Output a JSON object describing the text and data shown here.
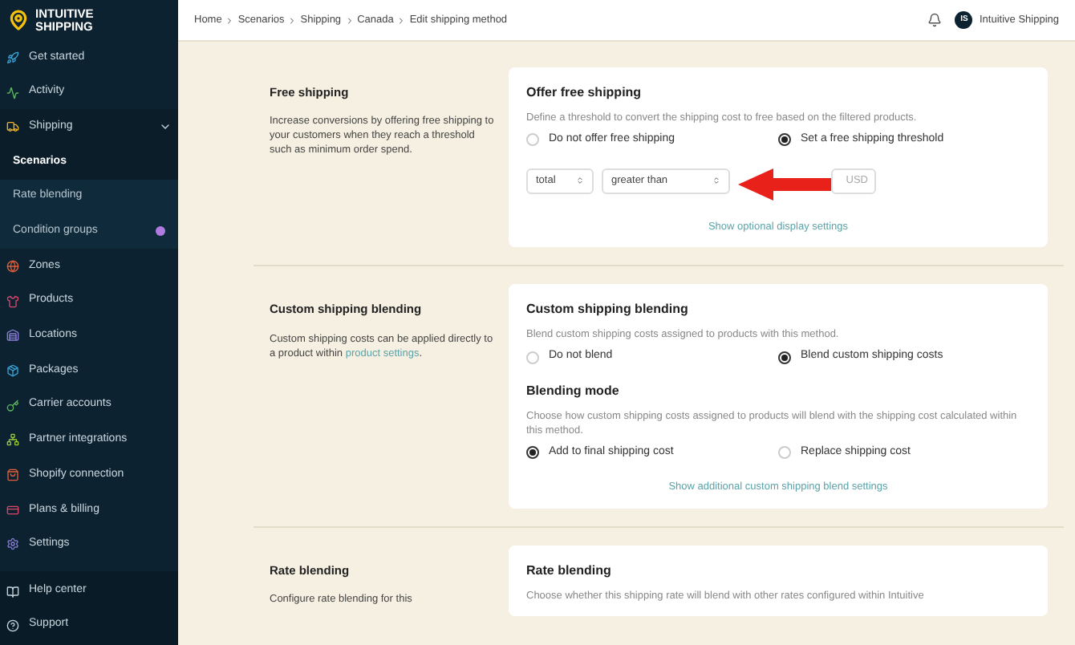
{
  "brand": {
    "line1": "INTUITIVE",
    "line2": "SHIPPING"
  },
  "sidebar": {
    "items": [
      {
        "label": "Get started",
        "selected": false
      },
      {
        "label": "Activity",
        "selected": false
      },
      {
        "label": "Shipping",
        "selected": false,
        "expanded": true,
        "children": [
          {
            "label": "Scenarios",
            "selected": true
          },
          {
            "label": "Rate blending",
            "selected": false
          },
          {
            "label": "Condition groups",
            "selected": false,
            "color": "#b07be0"
          }
        ]
      },
      {
        "label": "Zones",
        "selected": false
      },
      {
        "label": "Products",
        "selected": false
      },
      {
        "label": "Locations",
        "selected": false
      },
      {
        "label": "Packages",
        "selected": false
      },
      {
        "label": "Carrier accounts",
        "selected": false
      },
      {
        "label": "Partner integrations",
        "selected": false
      },
      {
        "label": "Shopify connection",
        "selected": false
      },
      {
        "label": "Plans & billing",
        "selected": false
      },
      {
        "label": "Settings",
        "selected": false
      }
    ],
    "footer": [
      {
        "label": "Help center"
      },
      {
        "label": "Support"
      }
    ]
  },
  "topbar": {
    "breadcrumbs": [
      "Home",
      "Scenarios",
      "Shipping",
      "Canada",
      "Edit shipping method"
    ],
    "avatar": "IS",
    "account": "Intuitive Shipping"
  },
  "sections": [
    {
      "title": "Free shipping",
      "description": "Increase conversions by offering free shipping to your customers when they reach a threshold such as minimum order spend.",
      "card": {
        "blocks": [
          {
            "title": "Offer free shipping",
            "text": "Define a threshold to convert the shipping cost to free based on the filtered products.",
            "options": [
              {
                "label": "Do not offer free shipping",
                "selected": false
              },
              {
                "label": "Set a free shipping threshold",
                "selected": true
              }
            ]
          }
        ],
        "selects": [
          "total",
          "greater than"
        ],
        "suffix": "USD",
        "link": "Show optional display settings"
      }
    },
    {
      "title": "Custom shipping blending",
      "description": "Custom shipping costs can be applied directly to a product within",
      "link": "product settings",
      "description_end": ".",
      "card": {
        "blocks": [
          {
            "title": "Custom shipping blending",
            "text": "Blend custom shipping costs assigned to products with this method.",
            "options": [
              {
                "label": "Do not blend",
                "selected": false
              },
              {
                "label": "Blend custom shipping costs",
                "selected": true
              }
            ]
          },
          {
            "title": "Blending mode",
            "text": "Choose how custom shipping costs assigned to products will blend with the shipping cost calculated within this method.",
            "options": [
              {
                "label": "Add to final shipping cost",
                "selected": true
              },
              {
                "label": "Replace shipping cost",
                "selected": false
              }
            ]
          }
        ],
        "link": "Show additional custom shipping blend settings"
      }
    },
    {
      "title": "Rate blending",
      "description": "Configure rate blending for this",
      "card": {
        "blocks": [
          {
            "title": "Rate blending",
            "text": "Choose whether this shipping rate will blend with other rates configured within Intuitive"
          }
        ]
      }
    }
  ]
}
